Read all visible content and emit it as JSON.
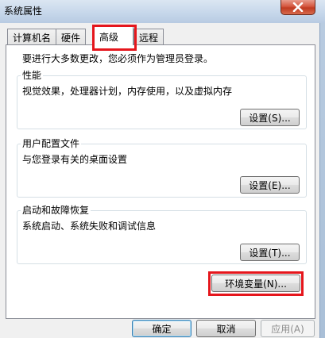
{
  "window": {
    "title": "系统属性",
    "close_icon": "close-icon"
  },
  "tabs": [
    {
      "label": "计算机名",
      "active": false
    },
    {
      "label": "硬件",
      "active": false
    },
    {
      "label": "高级",
      "active": true
    },
    {
      "label": "远程",
      "active": false
    }
  ],
  "advanced": {
    "admin_note": "要进行大多数更改，您必须作为管理员登录。",
    "performance": {
      "legend": "性能",
      "description": "视觉效果，处理器计划，内存使用，以及虚拟内存",
      "button": "设置(S)..."
    },
    "user_profiles": {
      "legend": "用户配置文件",
      "description": "与您登录有关的桌面设置",
      "button": "设置(E)..."
    },
    "startup_recovery": {
      "legend": "启动和故障恢复",
      "description": "系统启动、系统失败和调试信息",
      "button": "设置(T)..."
    },
    "env_button": "环境变量(N)..."
  },
  "footer": {
    "ok": "确定",
    "cancel": "取消",
    "apply": "应用(A)"
  },
  "colors": {
    "highlight": "#e5161c",
    "close_button": "#c8432a"
  }
}
